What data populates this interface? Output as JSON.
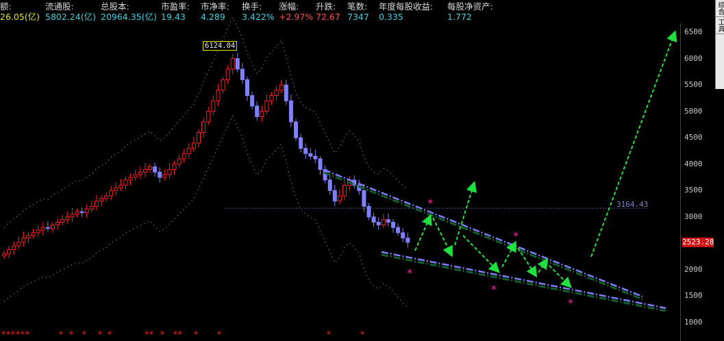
{
  "info_bar": [
    {
      "label": "额:",
      "value": "26.05(亿)",
      "color": "#e8e800"
    },
    {
      "label": "流通股:",
      "value": "5802.24(亿)",
      "color": "#40d0e0"
    },
    {
      "label": "总股本:",
      "value": "20964.35(亿)",
      "color": "#40d0e0"
    },
    {
      "label": "市盈率:",
      "value": "19.43",
      "color": "#40d0e0"
    },
    {
      "label": "市净率:",
      "value": "4.289",
      "color": "#40d0e0"
    },
    {
      "label": "换手:",
      "value": "3.422%",
      "color": "#40d0e0"
    },
    {
      "label": "涨幅:",
      "value": "+2.97%",
      "color": "#ff5050"
    },
    {
      "label": "升跌:",
      "value": "72.67",
      "color": "#ff5050"
    },
    {
      "label": "笔数:",
      "value": "7347",
      "color": "#40d0e0"
    },
    {
      "label": "年度每股收益:",
      "value": "0.335",
      "color": "#40d0e0"
    },
    {
      "label": "每股净资产:",
      "value": "1.772",
      "color": "#40d0e0"
    }
  ],
  "right_tabs": [
    "综合",
    "工具"
  ],
  "y_axis": {
    "ticks": [
      "6500",
      "6000",
      "5500",
      "5000",
      "4500",
      "4000",
      "3500",
      "3000",
      "2500",
      "2000",
      "1500",
      "1000"
    ]
  },
  "current_price": "2523.28",
  "reference_line_label": "3164.43",
  "peak_label": "6124.04",
  "colors": {
    "up": "#ff2020",
    "down": "#8080ff",
    "arrow": "#20e040",
    "trendline": "#8080ff",
    "star": "#ff20a0"
  },
  "chart_data": {
    "type": "candlestick",
    "peak": 6124.04,
    "reference_level": 3164.43,
    "last_close": 2523.28,
    "ylim": [
      1000,
      6500
    ]
  }
}
